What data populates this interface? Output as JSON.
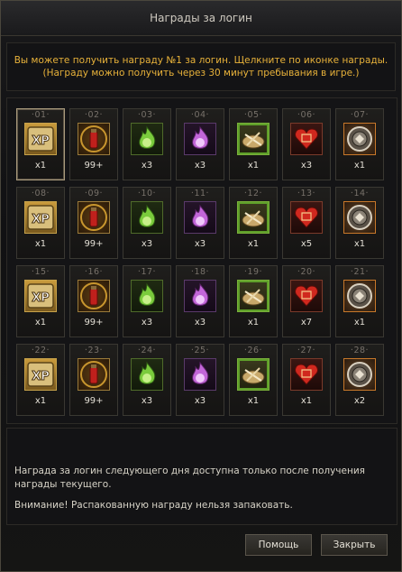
{
  "window": {
    "title": "Награды за логин",
    "notice_line1": "Вы можете получить награду №1 за логин. Щелкните по иконке награды.",
    "notice_line2": "(Награду можно получить через 30 минут пребывания в игре.)"
  },
  "rewards": [
    {
      "day": "01",
      "type": "xp",
      "count": "x1"
    },
    {
      "day": "02",
      "type": "potion",
      "count": "99+"
    },
    {
      "day": "03",
      "type": "green-flame",
      "count": "x3"
    },
    {
      "day": "04",
      "type": "purple-flame",
      "count": "x3"
    },
    {
      "day": "05",
      "type": "scroll",
      "count": "x1"
    },
    {
      "day": "06",
      "type": "heart",
      "count": "x3"
    },
    {
      "day": "07",
      "type": "medal",
      "count": "x1"
    },
    {
      "day": "08",
      "type": "xp",
      "count": "x1"
    },
    {
      "day": "09",
      "type": "potion",
      "count": "99+"
    },
    {
      "day": "10",
      "type": "green-flame",
      "count": "x3"
    },
    {
      "day": "11",
      "type": "purple-flame",
      "count": "x3"
    },
    {
      "day": "12",
      "type": "scroll",
      "count": "x1"
    },
    {
      "day": "13",
      "type": "heart",
      "count": "x5"
    },
    {
      "day": "14",
      "type": "medal",
      "count": "x1"
    },
    {
      "day": "15",
      "type": "xp",
      "count": "x1"
    },
    {
      "day": "16",
      "type": "potion",
      "count": "99+"
    },
    {
      "day": "17",
      "type": "green-flame",
      "count": "x3"
    },
    {
      "day": "18",
      "type": "purple-flame",
      "count": "x3"
    },
    {
      "day": "19",
      "type": "scroll",
      "count": "x1"
    },
    {
      "day": "20",
      "type": "heart",
      "count": "x7"
    },
    {
      "day": "21",
      "type": "medal",
      "count": "x1"
    },
    {
      "day": "22",
      "type": "xp",
      "count": "x1"
    },
    {
      "day": "23",
      "type": "potion",
      "count": "99+"
    },
    {
      "day": "24",
      "type": "green-flame",
      "count": "x3"
    },
    {
      "day": "25",
      "type": "purple-flame",
      "count": "x3"
    },
    {
      "day": "26",
      "type": "scroll",
      "count": "x1"
    },
    {
      "day": "27",
      "type": "heart",
      "count": "x1"
    },
    {
      "day": "28",
      "type": "medal",
      "count": "x2"
    }
  ],
  "info": {
    "line1": "Награда за логин следующего дня доступна только после получения награды текущего.",
    "line2": "Внимание! Распакованную награду нельзя запаковать."
  },
  "buttons": {
    "help": "Помощь",
    "close": "Закрыть"
  },
  "colors": {
    "notice_text": "#e8b23a",
    "panel_border": "#2c2a26",
    "selected_border": "#a89a7c"
  }
}
